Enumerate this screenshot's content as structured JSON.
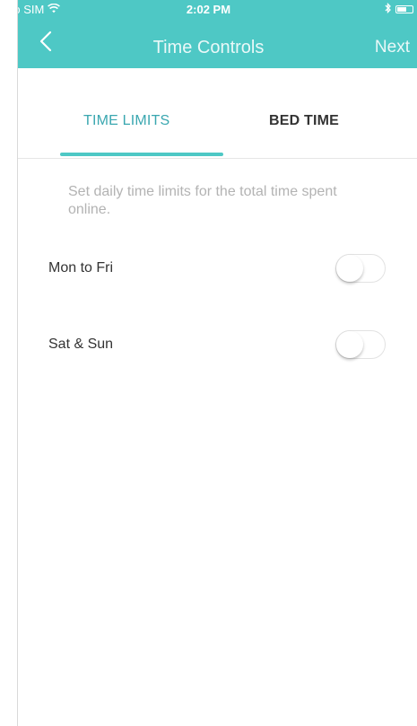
{
  "status_bar": {
    "carrier": "No SIM",
    "time": "2:02 PM",
    "wifi_icon": "wifi-icon",
    "bluetooth_icon": "bluetooth-icon",
    "battery_icon": "battery-icon"
  },
  "nav": {
    "title": "Time Controls",
    "back_icon": "chevron-left-icon",
    "next_label": "Next"
  },
  "tabs": [
    {
      "label": "TIME LIMITS",
      "active": true
    },
    {
      "label": "BED TIME",
      "active": false
    }
  ],
  "content": {
    "description": "Set daily time limits for the total time spent online.",
    "settings": [
      {
        "label": "Mon to Fri",
        "enabled": false
      },
      {
        "label": "Sat & Sun",
        "enabled": false
      }
    ]
  },
  "colors": {
    "accent": "#4ec8c5",
    "active_tab_text": "#3aa7b0",
    "primary_text": "#333333",
    "secondary_text": "#b3b3b3"
  }
}
